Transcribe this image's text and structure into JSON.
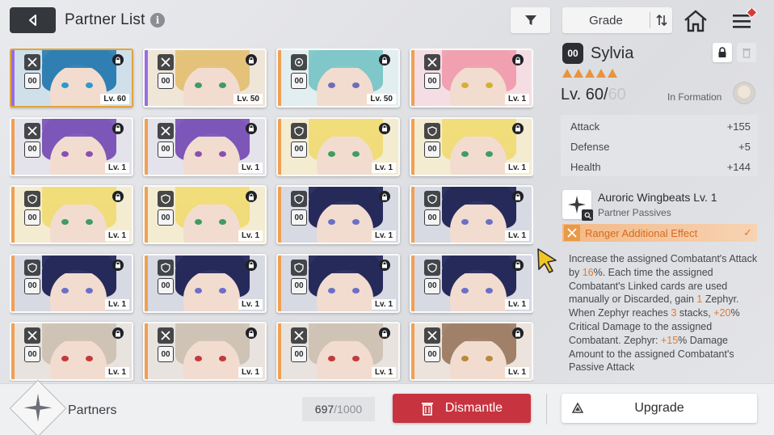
{
  "header": {
    "title": "Partner List",
    "info_icon": "info-icon",
    "sort_label": "Grade"
  },
  "cards": [
    {
      "tag": "00",
      "level": "Lv. 60",
      "class_icon": "crossed-swords-icon",
      "hair": "#2f7fb3",
      "eye": "#2b9ad0",
      "rarity": "#9a6de0",
      "bg": "#cfe0ea",
      "selected": true
    },
    {
      "tag": "00",
      "level": "Lv. 50",
      "class_icon": "crossed-swords-icon",
      "hair": "#e4c27a",
      "eye": "#3f9c63",
      "rarity": "#9a6de0",
      "bg": "#efe6d8",
      "selected": false
    },
    {
      "tag": "00",
      "level": "Lv. 50",
      "class_icon": "target-icon",
      "hair": "#7fc7c8",
      "eye": "#6c6fb8",
      "rarity": "#f0a053",
      "bg": "#e3eef0",
      "selected": false
    },
    {
      "tag": "00",
      "level": "Lv. 1",
      "class_icon": "crossed-swords-icon",
      "hair": "#f0a0b0",
      "eye": "#d4b033",
      "rarity": "#f0a053",
      "bg": "#f5dee3",
      "selected": false
    },
    {
      "tag": "00",
      "level": "Lv. 1",
      "class_icon": "crossed-swords-icon",
      "hair": "#7d56b8",
      "eye": "#8a4fb0",
      "rarity": "#f0a053",
      "bg": "#e4e2ea",
      "selected": false
    },
    {
      "tag": "00",
      "level": "Lv. 1",
      "class_icon": "crossed-swords-icon",
      "hair": "#7d56b8",
      "eye": "#8a4fb0",
      "rarity": "#f0a053",
      "bg": "#e4e2ea",
      "selected": false
    },
    {
      "tag": "00",
      "level": "Lv. 1",
      "class_icon": "shield-icon",
      "hair": "#f0dc7a",
      "eye": "#3f9c63",
      "rarity": "#f0a053",
      "bg": "#f4ecd0",
      "selected": false
    },
    {
      "tag": "00",
      "level": "Lv. 1",
      "class_icon": "shield-icon",
      "hair": "#f0dc7a",
      "eye": "#3f9c63",
      "rarity": "#f0a053",
      "bg": "#f4ecd0",
      "selected": false
    },
    {
      "tag": "00",
      "level": "Lv. 1",
      "class_icon": "shield-icon",
      "hair": "#f0dc7a",
      "eye": "#3f9c63",
      "rarity": "#f0a053",
      "bg": "#f4ecd0",
      "selected": false
    },
    {
      "tag": "00",
      "level": "Lv. 1",
      "class_icon": "shield-icon",
      "hair": "#f0dc7a",
      "eye": "#3f9c63",
      "rarity": "#f0a053",
      "bg": "#f4ecd0",
      "selected": false
    },
    {
      "tag": "00",
      "level": "Lv. 1",
      "class_icon": "shield-icon",
      "hair": "#262a5a",
      "eye": "#6a6fc8",
      "rarity": "#f0a053",
      "bg": "#d7d9e3",
      "selected": false
    },
    {
      "tag": "00",
      "level": "Lv. 1",
      "class_icon": "shield-icon",
      "hair": "#262a5a",
      "eye": "#6a6fc8",
      "rarity": "#f0a053",
      "bg": "#d7d9e3",
      "selected": false
    },
    {
      "tag": "00",
      "level": "Lv. 1",
      "class_icon": "shield-icon",
      "hair": "#262a5a",
      "eye": "#6a6fc8",
      "rarity": "#f0a053",
      "bg": "#d7d9e3",
      "selected": false
    },
    {
      "tag": "00",
      "level": "Lv. 1",
      "class_icon": "shield-icon",
      "hair": "#262a5a",
      "eye": "#6a6fc8",
      "rarity": "#f0a053",
      "bg": "#d7d9e3",
      "selected": false
    },
    {
      "tag": "00",
      "level": "Lv. 1",
      "class_icon": "shield-icon",
      "hair": "#262a5a",
      "eye": "#6a6fc8",
      "rarity": "#f0a053",
      "bg": "#d7d9e3",
      "selected": false
    },
    {
      "tag": "00",
      "level": "Lv. 1",
      "class_icon": "shield-icon",
      "hair": "#262a5a",
      "eye": "#6a6fc8",
      "rarity": "#f0a053",
      "bg": "#d7d9e3",
      "selected": false
    },
    {
      "tag": "00",
      "level": "Lv. 1",
      "class_icon": "crossed-swords-icon",
      "hair": "#cfc3b6",
      "eye": "#c23a3a",
      "rarity": "#f0a053",
      "bg": "#e8e3de",
      "selected": false
    },
    {
      "tag": "00",
      "level": "Lv. 1",
      "class_icon": "crossed-swords-icon",
      "hair": "#cfc3b6",
      "eye": "#c23a3a",
      "rarity": "#f0a053",
      "bg": "#e8e3de",
      "selected": false
    },
    {
      "tag": "00",
      "level": "Lv. 1",
      "class_icon": "crossed-swords-icon",
      "hair": "#cfc3b6",
      "eye": "#c23a3a",
      "rarity": "#f0a053",
      "bg": "#e8e3de",
      "selected": false
    },
    {
      "tag": "00",
      "level": "Lv. 1",
      "class_icon": "crossed-swords-icon",
      "hair": "#a08068",
      "eye": "#b88a3a",
      "rarity": "#f0a053",
      "bg": "#ece4dc",
      "selected": false
    }
  ],
  "detail": {
    "tag": "00",
    "name": "Sylvia",
    "stars": 5,
    "level_prefix": "Lv. 60/",
    "level_max": "60",
    "formation_label": "In Formation",
    "stats": [
      {
        "label": "Attack",
        "value": "+155"
      },
      {
        "label": "Defense",
        "value": "+5"
      },
      {
        "label": "Health",
        "value": "+144"
      }
    ],
    "passive_title": "Auroric Wingbeats Lv. 1",
    "passive_subtitle": "Partner Passives",
    "effect_label": "Ranger Additional Effect",
    "desc": {
      "p1": "Increase the assigned Combatant's Attack by ",
      "v1": "16",
      "p2": "%. Each time the assigned Combatant's Linked cards are used manually or Discarded, gain ",
      "v2": "1",
      "p3": " Zephyr. When Zephyr reaches ",
      "v3": "3",
      "p4": " stacks, ",
      "v4": "+20",
      "p5": "% Critical Damage to the assigned Combatant. Zephyr: ",
      "v5": "+15",
      "p6": "% Damage Amount to the assigned Combatant's Passive Attack"
    }
  },
  "footer": {
    "section_label": "Partners",
    "count_current": "697",
    "count_total": "1000",
    "count_separator": " / ",
    "dismantle_label": "Dismantle",
    "upgrade_label": "Upgrade"
  },
  "colors": {
    "accent_orange": "#e07a30",
    "dismantle_red": "#c7343f",
    "selected_border": "#e3a33a"
  }
}
